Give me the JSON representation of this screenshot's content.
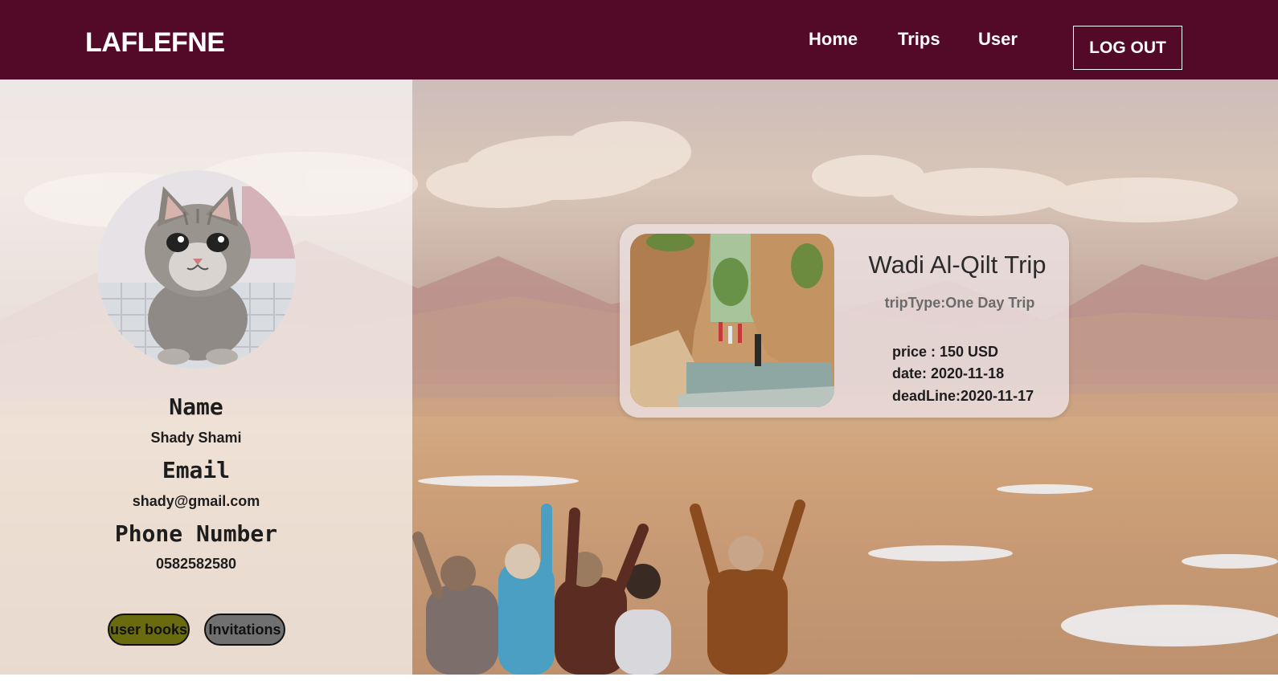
{
  "navbar": {
    "brand": "LAFLEFNE",
    "links": {
      "home": "Home",
      "trips": "Trips",
      "user": "User"
    },
    "logout_label": "LOG OUT",
    "bg_color": "#530a29"
  },
  "profile": {
    "name_label": "Name",
    "name_value": "Shady Shami",
    "email_label": "Email",
    "email_value": "shady@gmail.com",
    "phone_label": "Phone Number",
    "phone_value": "0582582580",
    "avatar_icon": "kitten-photo"
  },
  "buttons": {
    "user_books": "user books",
    "invitations": "Invitations"
  },
  "trip_card": {
    "title": "Wadi Al-Qilt Trip",
    "trip_type": "tripType:One Day Trip",
    "price": "price : 150 USD",
    "date": "date: 2020-11-18",
    "deadline": "deadLine:2020-11-17",
    "image_icon": "canyon-photo"
  }
}
